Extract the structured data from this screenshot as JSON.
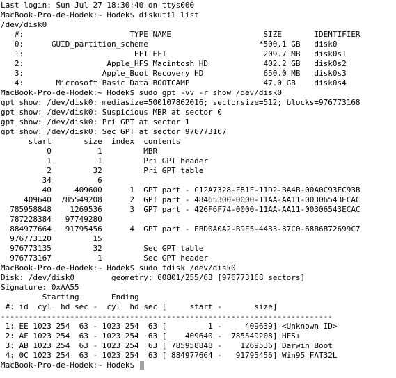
{
  "terminal": {
    "lines": [
      "Last login: Sun Jul 27 18:30:40 on ttys000",
      "MacBook-Pro-de-Hodek:~ Hodek$ diskutil list",
      "/dev/disk0",
      "   #:                       TYPE NAME                    SIZE       IDENTIFIER",
      "   0:      GUID_partition_scheme                        *500.1 GB   disk0",
      "   1:                        EFI EFI                     209.7 MB   disk0s1",
      "   2:                  Apple_HFS Macintosh HD            402.2 GB   disk0s2",
      "   3:                 Apple_Boot Recovery HD             650.0 MB   disk0s3",
      "   4:       Microsoft Basic Data BOOTCAMP                47.0 GB    disk0s4",
      "MacBook-Pro-de-Hodek:~ Hodek$ sudo gpt -vv -r show /dev/disk0",
      "gpt show: /dev/disk0: mediasize=500107862016; sectorsize=512; blocks=976773168",
      "gpt show: /dev/disk0: Suspicious MBR at sector 0",
      "gpt show: /dev/disk0: Pri GPT at sector 1",
      "gpt show: /dev/disk0: Sec GPT at sector 976773167",
      "      start       size  index  contents",
      "          0          1         MBR",
      "          1          1         Pri GPT header",
      "          2         32         Pri GPT table",
      "         34          6",
      "         40     409600      1  GPT part - C12A7328-F81F-11D2-BA4B-00A0C93EC93B",
      "     409640  785549208      2  GPT part - 48465300-0000-11AA-AA11-00306543ECAC",
      "  785958848    1269536      3  GPT part - 426F6F74-0000-11AA-AA11-00306543ECAC",
      "  787228384   97749280",
      "  884977664   91795456      4  GPT part - EBD0A0A2-B9E5-4433-87C0-68B6B72699C7",
      "  976773120         15",
      "  976773135         32         Sec GPT table",
      "  976773167          1         Sec GPT header",
      "MacBook-Pro-de-Hodek:~ Hodek$ sudo fdisk /dev/disk0",
      "Disk: /dev/disk0        geometry: 60801/255/63 [976773168 sectors]",
      "Signature: 0xAA55",
      "         Starting       Ending",
      " #: id  cyl  hd sec -  cyl  hd sec [     start -       size]",
      "------------------------------------------------------------------------",
      " 1: EE 1023 254  63 - 1023 254  63 [         1 -     409639] <Unknown ID>",
      " 2: AF 1023 254  63 - 1023 254  63 [    409640 -  785549208] HFS+",
      " 3: AB 1023 254  63 - 1023 254  63 [ 785958848 -    1269536] Darwin Boot",
      " 4: 0C 1023 254  63 - 1023 254  63 [ 884977664 -   91795456] Win95 FAT32L"
    ],
    "prompt": "MacBook-Pro-de-Hodek:~ Hodek$ ",
    "cursor_color": "#a0a0a0",
    "background_color": "#ffffff",
    "text_color": "#000000"
  }
}
